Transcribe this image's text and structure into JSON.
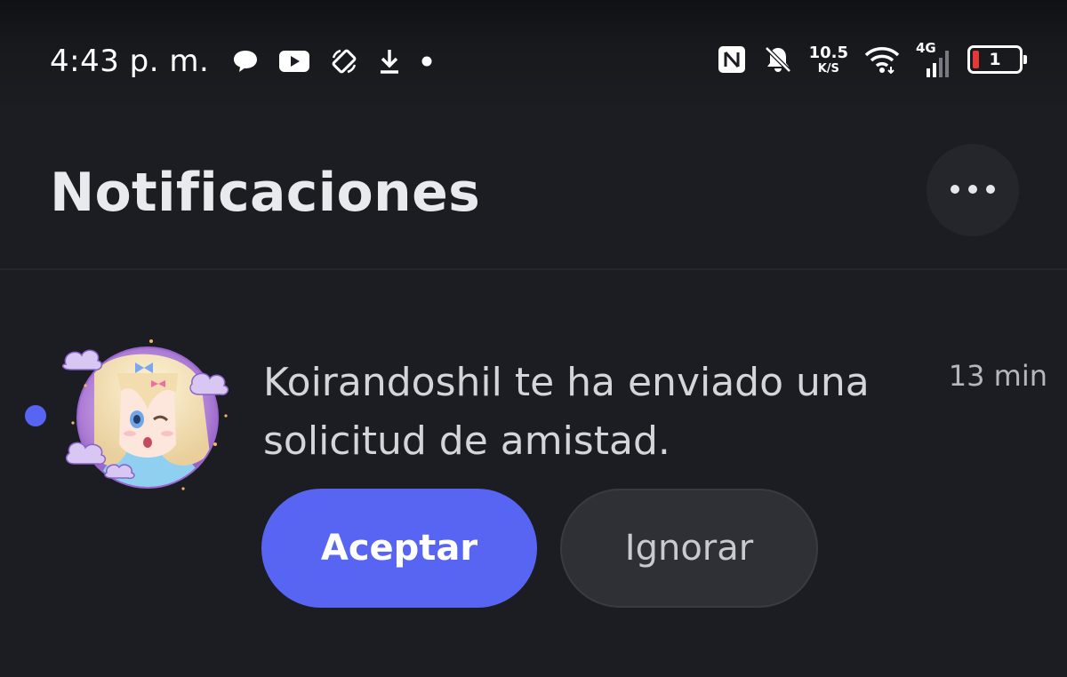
{
  "status_bar": {
    "time": "4:43 p. m.",
    "icons_left": [
      "chat-bubble-icon",
      "youtube-icon",
      "rotate-lock-icon",
      "download-icon",
      "dot-icon"
    ],
    "icons_right": [
      "nfc-icon",
      "bell-off-icon",
      "wifi-icon",
      "cellular-signal-icon",
      "battery-icon"
    ],
    "net_speed_value": "10.5",
    "net_speed_unit": "K/S",
    "network_type": "4G",
    "battery_level": "1",
    "battery_color": "#e53935"
  },
  "header": {
    "title": "Notificaciones",
    "more_icon": "more-horizontal-icon"
  },
  "notification": {
    "unread": true,
    "unread_color": "#5865f2",
    "message": "Koirandoshil te ha enviado una solicitud de amistad.",
    "time": "13 min",
    "accept_label": "Aceptar",
    "ignore_label": "Ignorar"
  },
  "colors": {
    "background": "#1c1d22",
    "accent": "#5865f2",
    "secondary_button": "#2f3036"
  }
}
